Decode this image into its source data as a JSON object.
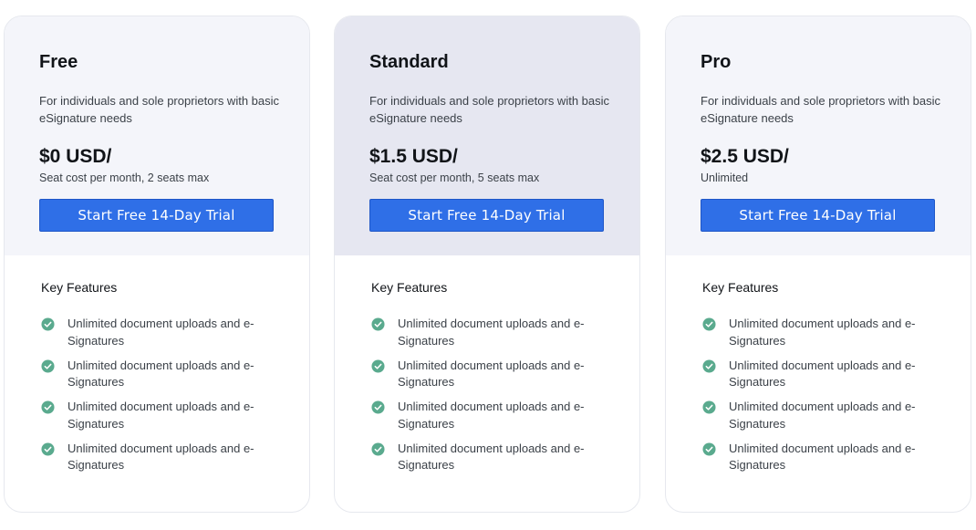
{
  "plans": [
    {
      "name": "Free",
      "description": "For individuals and sole proprietors with basic eSignature needs",
      "price": "$0 USD/",
      "price_note": "Seat cost per month, 2 seats max",
      "cta_label": "Start Free 14-Day Trial",
      "features_title": "Key Features",
      "features": [
        "Unlimited document uploads and e-Signatures",
        "Unlimited document uploads and e-Signatures",
        "Unlimited document uploads and e-Signatures",
        "Unlimited document uploads and e-Signatures"
      ]
    },
    {
      "name": "Standard",
      "description": "For individuals and sole proprietors with basic eSignature needs",
      "price": "$1.5 USD/",
      "price_note": "Seat cost per month, 5 seats max",
      "cta_label": "Start Free 14-Day Trial",
      "features_title": "Key Features",
      "features": [
        "Unlimited document uploads and e-Signatures",
        "Unlimited document uploads and e-Signatures",
        "Unlimited document uploads and e-Signatures",
        "Unlimited document uploads and e-Signatures"
      ]
    },
    {
      "name": "Pro",
      "description": "For individuals and sole proprietors with basic eSignature needs",
      "price": "$2.5 USD/",
      "price_note": "Unlimited",
      "cta_label": "Start Free 14-Day Trial",
      "features_title": "Key Features",
      "features": [
        "Unlimited document uploads and e-Signatures",
        "Unlimited document uploads and e-Signatures",
        "Unlimited document uploads and e-Signatures",
        "Unlimited document uploads and e-Signatures"
      ]
    }
  ],
  "colors": {
    "accent": "#2f6fe7",
    "check": "#5aaa8e",
    "card_top_default": "#f4f5fa",
    "card_top_highlight": "#e6e7f1"
  },
  "icons": {
    "feature_icon": "check-circle-icon"
  }
}
